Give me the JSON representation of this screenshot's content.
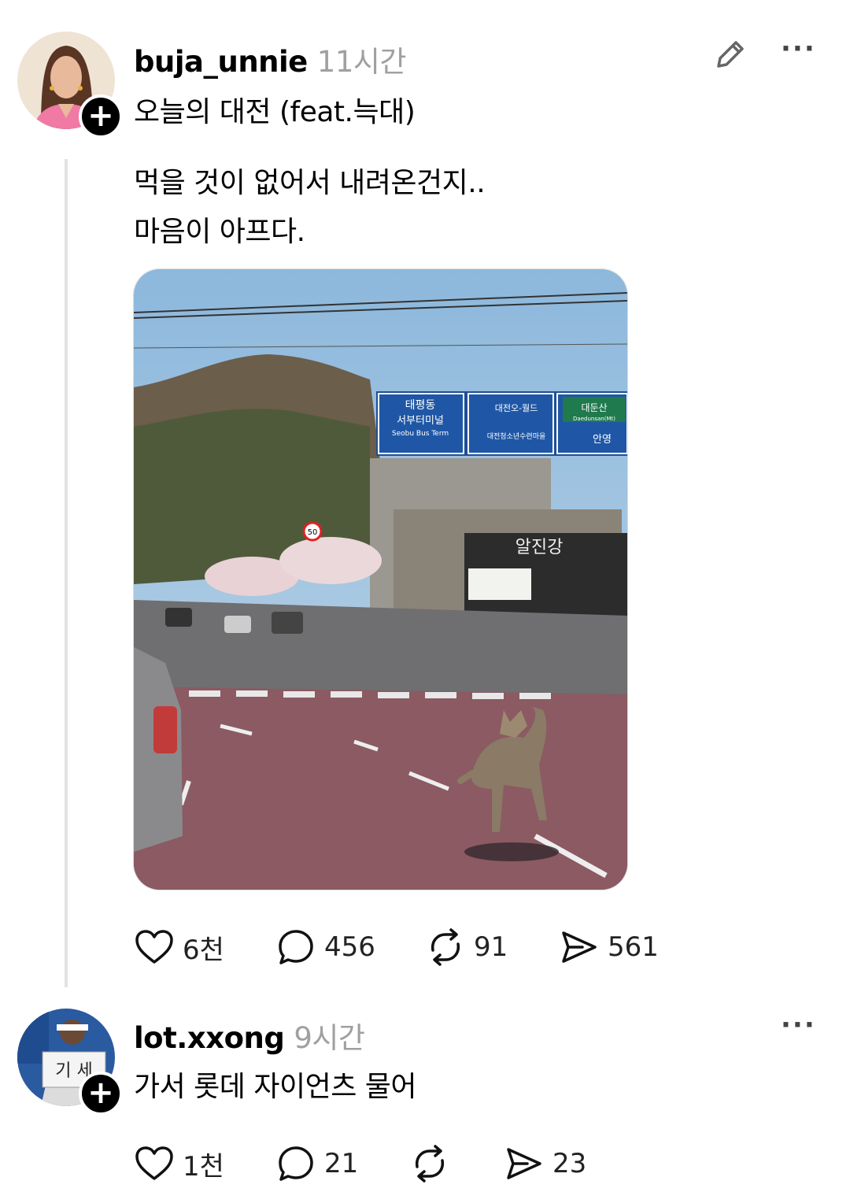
{
  "post": {
    "username": "buja_unnie",
    "time": "11시간",
    "title": "오늘의 대전 (feat.늑대)",
    "body_lines": [
      "먹을 것이 없어서 내려온건지..",
      "마음이 아프다."
    ],
    "image_signs": {
      "sign1_ko": "태평동",
      "sign1_ko2": "서부터미널",
      "sign1_en": "Seobu Bus Term",
      "sign2_ko": "대전오-월드",
      "sign2_ko2": "대전청소년수련마을",
      "sign3_ko": "대둔산",
      "sign3_en": "Daedunsan(Mt)",
      "sign3_ko2": "안영",
      "speed": "50",
      "shop": "알진강"
    },
    "stats": {
      "likes": "6천",
      "comments": "456",
      "reposts": "91",
      "shares": "561"
    }
  },
  "reply": {
    "username": "lot.xxong",
    "time": "9시간",
    "text": "가서 롯데 자이언츠 물어",
    "avatar_sign": "기 세",
    "stats": {
      "likes": "1천",
      "comments": "21",
      "reposts": "",
      "shares": "23"
    }
  },
  "icons": [
    "edit-icon",
    "more-icon",
    "heart-icon",
    "comment-icon",
    "repost-icon",
    "share-icon",
    "plus-icon"
  ],
  "colors": {
    "text": "#000000",
    "muted": "#a0a0a0",
    "line": "#e2e2e2"
  }
}
